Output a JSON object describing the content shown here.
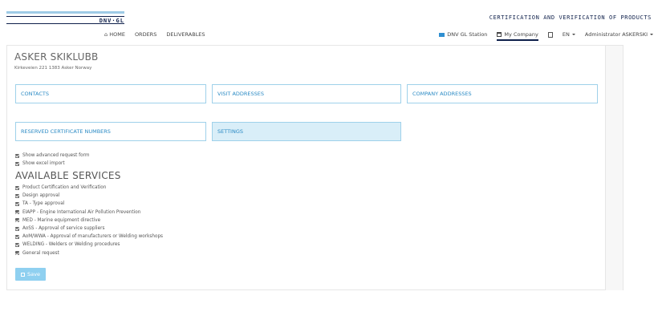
{
  "header": {
    "logo_text": "DNV·GL",
    "title": "CERTIFICATION AND VERIFICATION OF PRODUCTS"
  },
  "nav": {
    "left": [
      {
        "label": "HOME",
        "icon": "home-icon"
      },
      {
        "label": "ORDERS"
      },
      {
        "label": "DELIVERABLES"
      }
    ],
    "right": {
      "station": "DNV GL Station",
      "company": "My Company",
      "language": "EN",
      "user": "Administrator ASKERSKI"
    }
  },
  "company": {
    "name": "ASKER SKIKLUBB",
    "address": "Kirkeveien 221  1383 Asker Norway"
  },
  "tiles": {
    "contacts": "CONTACTS",
    "visit_addresses": "VISIT ADDRESSES",
    "company_addresses": "COMPANY ADDRESSES",
    "reserved": "RESERVED CERTIFICATE NUMBERS",
    "settings": "SETTINGS"
  },
  "options": [
    "Show advanced request form",
    "Show excel import"
  ],
  "services_title": "AVAILABLE SERVICES",
  "services": [
    "Product Certification and Verification",
    "Design approval",
    "TA - Type approval",
    "EIAPP - Engine International Air Pollution Prevention",
    "MED - Marine equipment directive",
    "AoSS - Approval of service suppliers",
    "AoM/WWA - Approval of manufacturers or Welding workshops",
    "WELDING - Welders or Welding procedures",
    "General request"
  ],
  "save_label": "Save",
  "colors": {
    "brand_dark": "#0f204b",
    "brand_light": "#9ecbe6",
    "tile_border": "#9fd1ea",
    "tile_text": "#2a8ac4",
    "save_button": "#8fd0f0"
  }
}
